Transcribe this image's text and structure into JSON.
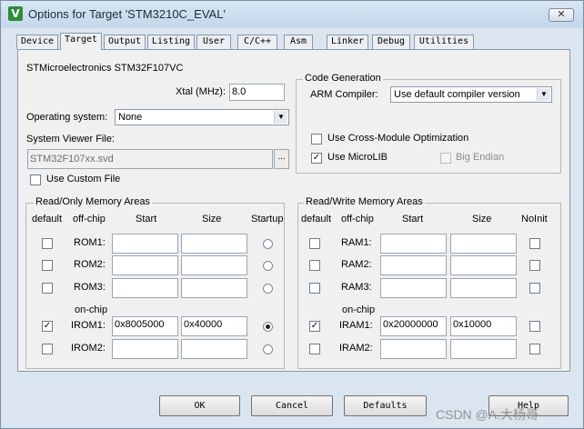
{
  "window": {
    "title": "Options for Target 'STM3210C_EVAL'",
    "icon": "keil-uvision-icon",
    "close_glyph": "✕"
  },
  "tabs": [
    "Device",
    "Target",
    "Output",
    "Listing",
    "User",
    "C/C++",
    "Asm",
    "Linker",
    "Debug",
    "Utilities"
  ],
  "active_tab": "Target",
  "target": {
    "device_name": "STMicroelectronics STM32F107VC",
    "xtal_label": "Xtal (MHz):",
    "xtal_value": "8.0",
    "os_label": "Operating system:",
    "os_value": "None",
    "svd_label": "System Viewer File:",
    "svd_value": "STM32F107xx.svd",
    "browse_label": "...",
    "use_custom_file": {
      "label": "Use Custom File",
      "checked": false
    }
  },
  "code_generation": {
    "title": "Code Generation",
    "arm_compiler_label": "ARM Compiler:",
    "arm_compiler_value": "Use default compiler version",
    "cross_module": {
      "label": "Use Cross-Module Optimization",
      "checked": false
    },
    "microlib": {
      "label": "Use MicroLIB",
      "checked": true
    },
    "big_endian": {
      "label": "Big Endian",
      "checked": false,
      "disabled": true
    }
  },
  "ro_memory": {
    "title": "Read/Only Memory Areas",
    "headers": {
      "default": "default",
      "offchip": "off-chip",
      "start": "Start",
      "size": "Size",
      "startup": "Startup"
    },
    "onchip_label": "on-chip",
    "rows": [
      {
        "name": "ROM1:",
        "default": false,
        "start": "",
        "size": "",
        "startup": false
      },
      {
        "name": "ROM2:",
        "default": false,
        "start": "",
        "size": "",
        "startup": false
      },
      {
        "name": "ROM3:",
        "default": false,
        "start": "",
        "size": "",
        "startup": false
      },
      {
        "name": "IROM1:",
        "default": true,
        "start": "0x8005000",
        "size": "0x40000",
        "startup": true
      },
      {
        "name": "IROM2:",
        "default": false,
        "start": "",
        "size": "",
        "startup": false
      }
    ]
  },
  "rw_memory": {
    "title": "Read/Write Memory Areas",
    "headers": {
      "default": "default",
      "offchip": "off-chip",
      "start": "Start",
      "size": "Size",
      "noinit": "NoInit"
    },
    "onchip_label": "on-chip",
    "rows": [
      {
        "name": "RAM1:",
        "default": false,
        "start": "",
        "size": "",
        "noinit": false
      },
      {
        "name": "RAM2:",
        "default": false,
        "start": "",
        "size": "",
        "noinit": false
      },
      {
        "name": "RAM3:",
        "default": false,
        "start": "",
        "size": "",
        "noinit": false
      },
      {
        "name": "IRAM1:",
        "default": true,
        "start": "0x20000000",
        "size": "0x10000",
        "noinit": false
      },
      {
        "name": "IRAM2:",
        "default": false,
        "start": "",
        "size": "",
        "noinit": false
      }
    ]
  },
  "buttons": {
    "ok": "OK",
    "cancel": "Cancel",
    "defaults": "Defaults",
    "help": "Help"
  },
  "watermark": "CSDN @A.大杨哥",
  "glyphs": {
    "check": "✓",
    "dropdown": "▼"
  }
}
